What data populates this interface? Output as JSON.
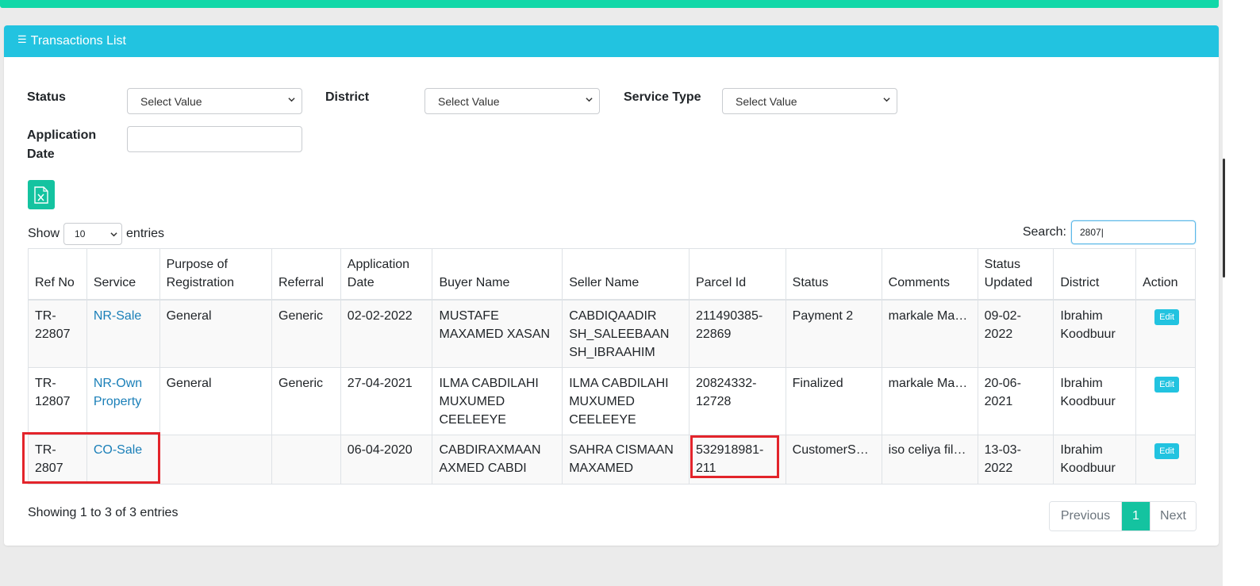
{
  "header": {
    "title": "Transactions List",
    "icon": "list-icon"
  },
  "filters": {
    "status_label": "Status",
    "status_value": "Select Value",
    "district_label": "District",
    "district_value": "Select Value",
    "service_type_label": "Service Type",
    "service_type_value": "Select Value",
    "application_date_label_1": "Application",
    "application_date_label_2": "Date",
    "application_date_value": ""
  },
  "export": {
    "icon": "excel-export-icon"
  },
  "length": {
    "show_label": "Show",
    "value": "10",
    "entries_label": "entries"
  },
  "search": {
    "label": "Search:",
    "value": "2807|"
  },
  "table": {
    "headers": [
      "Ref No",
      "Service",
      "Purpose of Registration",
      "Referral",
      "Application Date",
      "Buyer Name",
      "Seller Name",
      "Parcel Id",
      "Status",
      "Comments",
      "Status Updated",
      "District",
      "Action"
    ],
    "rows": [
      {
        "ref_no": "TR-22807",
        "service": "NR-Sale",
        "purpose": "General",
        "referral": "Generic",
        "app_date": "02-02-2022",
        "buyer": "MUSTAFE MAXAMED XASAN",
        "seller": "CABDIQAADIR SH_SALEEBAAN SH_IBRAAHIM",
        "parcel": "211490385-22869",
        "status": "Payment 2",
        "comments": "markale Mac...",
        "updated": "09-02-2022",
        "district": "Ibrahim Koodbuur",
        "action": "Edit"
      },
      {
        "ref_no": "TR-12807",
        "service": "NR-Own Property",
        "purpose": "General",
        "referral": "Generic",
        "app_date": "27-04-2021",
        "buyer": "ILMA CABDILAHI MUXUMED CEELEEYE",
        "seller": "ILMA CABDILAHI MUXUMED CEELEEYE",
        "parcel": "20824332-12728",
        "status": "Finalized",
        "comments": "markale Mac...",
        "updated": "20-06-2021",
        "district": "Ibrahim Koodbuur",
        "action": "Edit"
      },
      {
        "ref_no": "TR-2807",
        "service": "CO-Sale",
        "purpose": "",
        "referral": "",
        "app_date": "06-04-2020",
        "buyer": "CABDIRAXMAAN AXMED CABDI",
        "seller": "SAHRA CISMAAN MAXAMED",
        "parcel": "532918981-211",
        "status": "CustomerSer...",
        "comments": "iso celiya file...",
        "updated": "13-03-2022",
        "district": "Ibrahim Koodbuur",
        "action": "Edit"
      }
    ]
  },
  "footer": {
    "info": "Showing 1 to 3 of 3 entries",
    "prev": "Previous",
    "current": "1",
    "next": "Next"
  },
  "colors": {
    "header": "#22c3e0",
    "accent": "#14c3a0",
    "top_bar": "#10d8a8",
    "link": "#1a7fb8",
    "highlight": "#e3242b"
  }
}
